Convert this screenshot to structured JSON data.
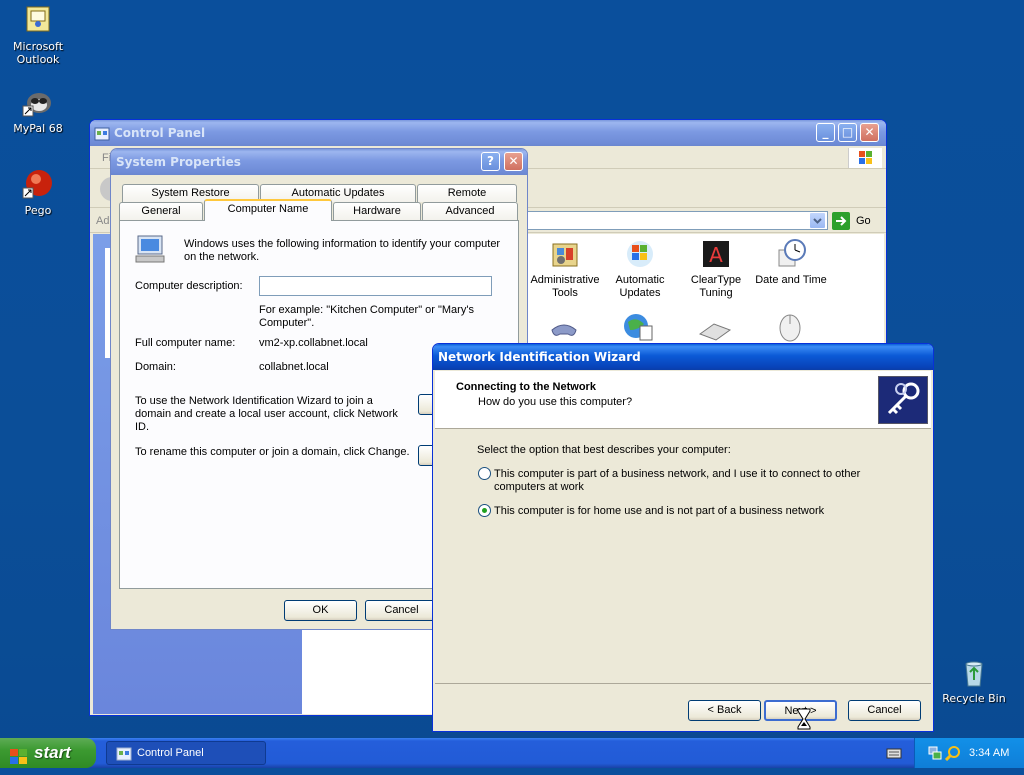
{
  "desktop": {
    "icons": [
      {
        "label_line1": "Microsoft",
        "label_line2": "Outlook"
      },
      {
        "label": "MyPal 68"
      },
      {
        "label": "Pego"
      },
      {
        "label": "Recycle Bin"
      }
    ]
  },
  "control_panel": {
    "title": "Control Panel",
    "go_label": "Go",
    "menu_fragment": "Fi",
    "address_fragment": "Ad",
    "items": [
      {
        "label_line1": "Administrative",
        "label_line2": "Tools"
      },
      {
        "label_line1": "Automatic",
        "label_line2": "Updates"
      },
      {
        "label_line1": "ClearType",
        "label_line2": "Tuning"
      },
      {
        "label_line1": "Date and Time",
        "label_line2": ""
      }
    ]
  },
  "system_properties": {
    "title": "System Properties",
    "tabs_row1": [
      "System Restore",
      "Automatic Updates",
      "Remote"
    ],
    "tabs_row2": [
      "General",
      "Computer Name",
      "Hardware",
      "Advanced"
    ],
    "intro_line1": "Windows uses the following information to identify your computer",
    "intro_line2": "on the network.",
    "computer_description_label": "Computer description:",
    "computer_description_value": "",
    "example_line1": "For example: \"Kitchen Computer\" or \"Mary's",
    "example_line2": "Computer\".",
    "full_name_label": "Full computer name:",
    "full_name_value": "vm2-xp.collabnet.local",
    "domain_label": "Domain:",
    "domain_value": "collabnet.local",
    "network_id_text_line1": "To use the Network Identification Wizard to join a",
    "network_id_text_line2": "domain and create a local user account, click Network",
    "network_id_text_line3": "ID.",
    "network_id_button": "N",
    "rename_text": "To rename this computer or join a domain, click Change.",
    "change_button": "",
    "ok_button": "OK",
    "cancel_button": "Cancel"
  },
  "wizard": {
    "title": "Network Identification Wizard",
    "header_title": "Connecting to the Network",
    "header_subtitle": "How do you use this computer?",
    "prompt": "Select the option that best describes your computer:",
    "option1_line1": "This computer is part of a business network, and I use it to connect to other",
    "option1_line2": "computers at work",
    "option2": "This computer is for home use and is not part of a business network",
    "selected_option": 2,
    "back_button": "< Back",
    "next_button": "Next >",
    "cancel_button": "Cancel"
  },
  "taskbar": {
    "start_label": "start",
    "task_label": "Control Panel",
    "clock": "3:34 AM"
  }
}
